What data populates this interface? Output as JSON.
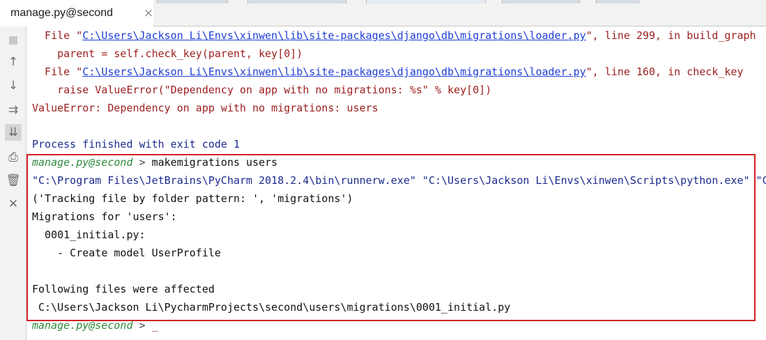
{
  "tab": {
    "title": "manage.py@second",
    "close_glyph": "×"
  },
  "toolbar": {
    "items": [
      {
        "name": "stop-icon",
        "glyph": ""
      },
      {
        "name": "up-arrow-icon",
        "glyph": "↑"
      },
      {
        "name": "down-arrow-icon",
        "glyph": "↓"
      },
      {
        "name": "soft-wrap-icon",
        "glyph": "⇉"
      },
      {
        "name": "scroll-to-end-icon",
        "glyph": "⇊"
      },
      {
        "name": "print-icon",
        "glyph": "⎙"
      },
      {
        "name": "trash-icon",
        "glyph": "🗑"
      },
      {
        "name": "close-icon",
        "glyph": "✕"
      }
    ]
  },
  "console": {
    "tb1_prefix": "  File \"",
    "tb1_link": "C:\\Users\\Jackson Li\\Envs\\xinwen\\lib\\site-packages\\django\\db\\migrations\\loader.py",
    "tb1_suffix": "\", line 299, in build_graph",
    "tb1_code": "    parent = self.check_key(parent, key[0])",
    "tb2_prefix": "  File \"",
    "tb2_link": "C:\\Users\\Jackson Li\\Envs\\xinwen\\lib\\site-packages\\django\\db\\migrations\\loader.py",
    "tb2_suffix": "\", line 160, in check_key",
    "tb2_code": "    raise ValueError(\"Dependency on app with no migrations: %s\" % key[0])",
    "error": "ValueError: Dependency on app with no migrations: users",
    "process": "Process finished with exit code 1",
    "prompt": "manage.py@second",
    "prompt_arrow": " > ",
    "command": "makemigrations users",
    "run_cmd": "\"C:\\Program Files\\JetBrains\\PyCharm 2018.2.4\\bin\\runnerw.exe\" \"C:\\Users\\Jackson Li\\Envs\\xinwen\\Scripts\\python.exe\" \"C",
    "tracking": "('Tracking file by folder pattern: ', 'migrations')",
    "migrations_for": "Migrations for 'users':",
    "migration_file": "  0001_initial.py:",
    "create_model": "    - Create model UserProfile",
    "affected": "Following files were affected",
    "affected_path": " C:\\Users\\Jackson Li\\PycharmProjects\\second\\users\\migrations\\0001_initial.py",
    "caret": "_"
  },
  "colors": {
    "highlight_box": "#d32124",
    "error": "#9b1e1e",
    "link": "#1f3dd6",
    "prompt": "#2f8a3b"
  }
}
